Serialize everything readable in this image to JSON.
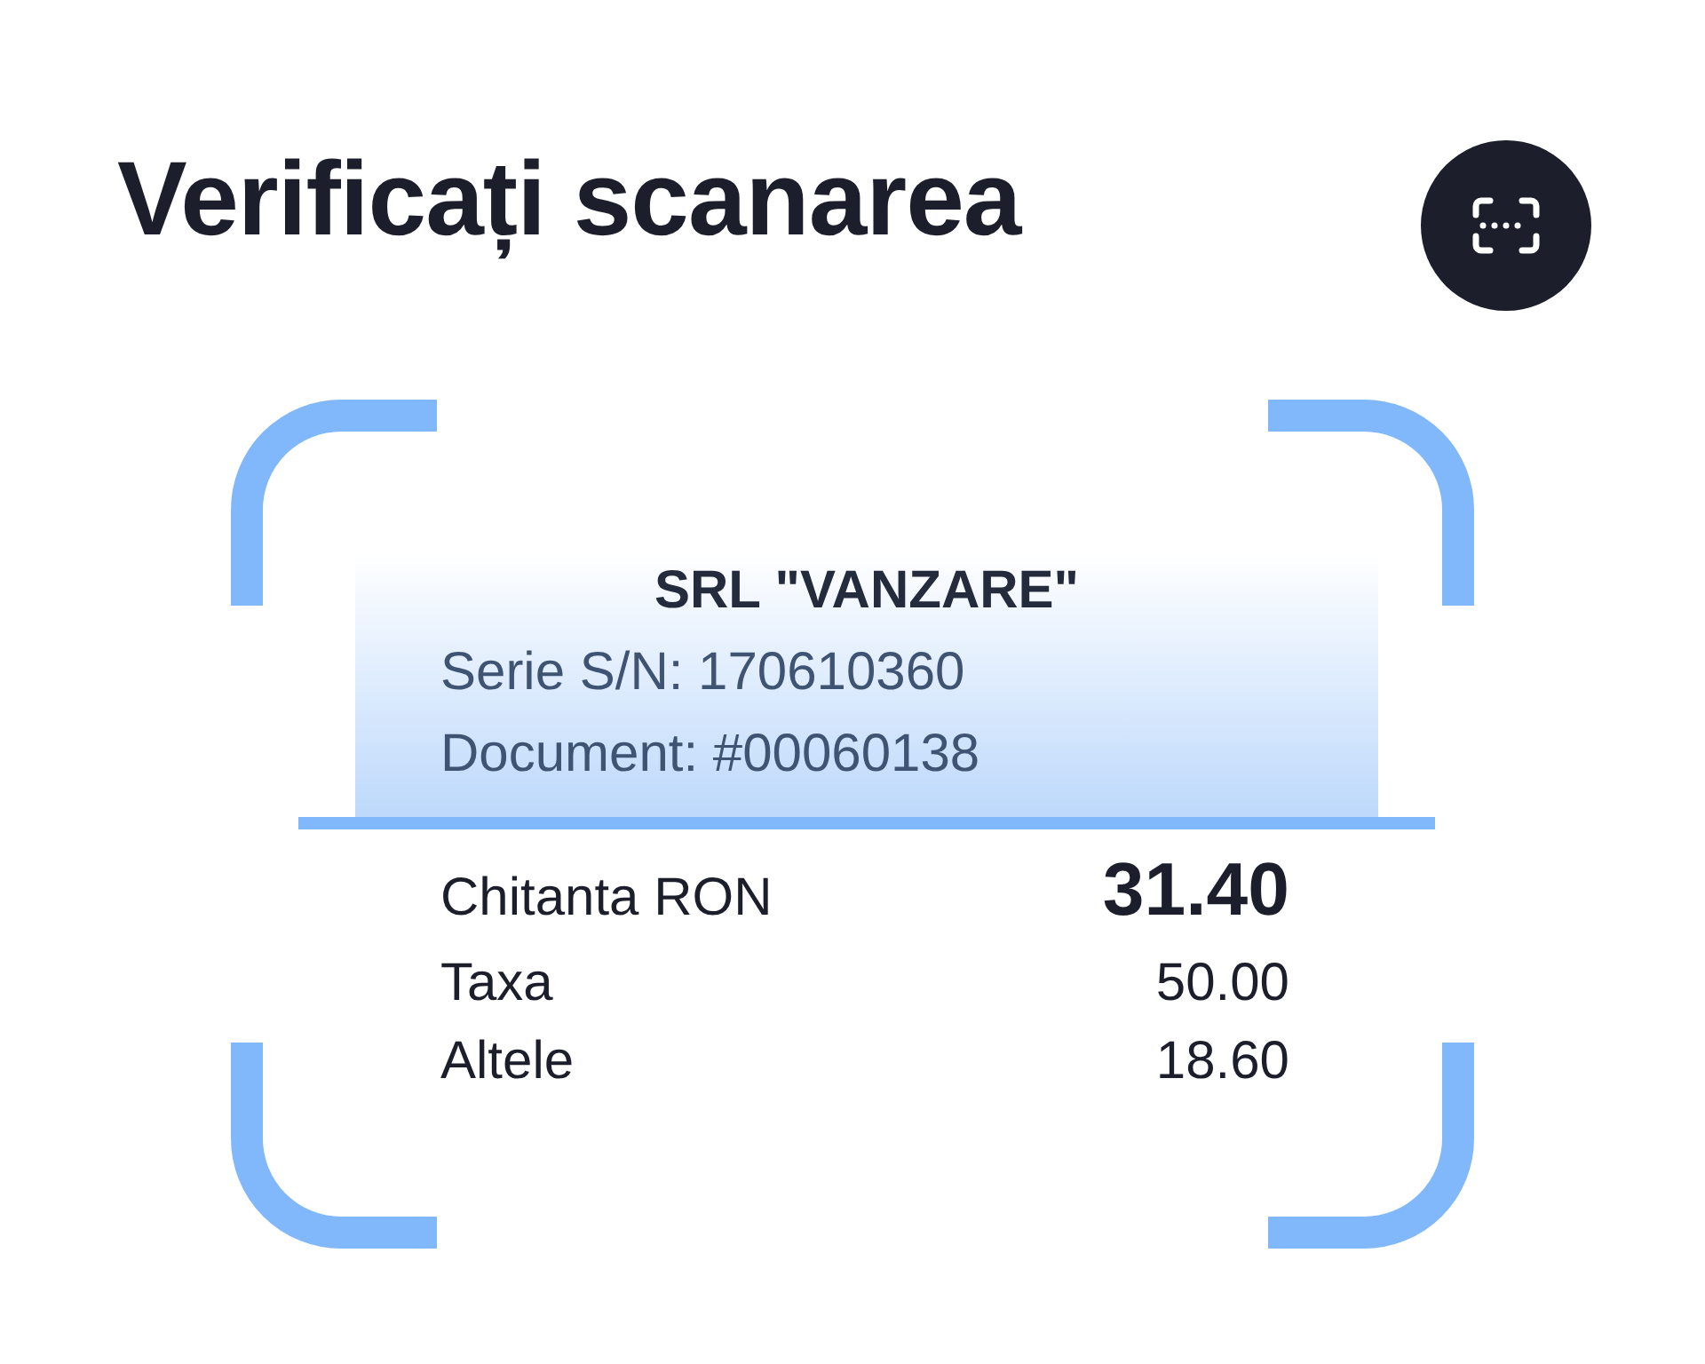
{
  "title": "Verificați scanarea",
  "receipt": {
    "merchant": "SRL \"VANZARE\"",
    "details": [
      "Serie S/N: 170610360",
      "Document: #00060138"
    ],
    "total": {
      "label": "Chitanta RON",
      "amount": "31.40"
    },
    "items": [
      {
        "label": "Taxa",
        "amount": "50.00"
      },
      {
        "label": "Altele",
        "amount": "18.60"
      }
    ]
  }
}
